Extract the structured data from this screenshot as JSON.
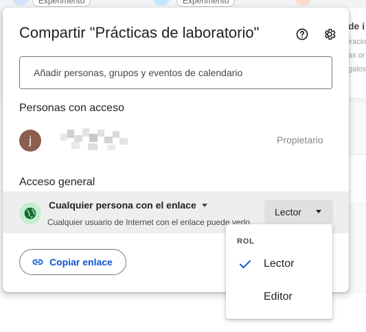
{
  "background": {
    "chips": [
      "Experimento",
      "Experimento"
    ],
    "side_title": "de i",
    "side_lines": [
      "iracio",
      "as or",
      "galos"
    ]
  },
  "dialog": {
    "title": "Compartir \"Prácticas de laboratorio\"",
    "help_icon": "help-circle-icon",
    "settings_icon": "gear-icon",
    "add_input_placeholder": "Añadir personas, grupos y eventos de calendario",
    "people_section_title": "Personas con acceso",
    "people": [
      {
        "avatar_letter": "j",
        "name": "",
        "role": "Propietario"
      }
    ],
    "general_section_title": "Acceso general",
    "general_access": {
      "icon": "globe-icon",
      "link_option": "Cualquier persona con el enlace",
      "description": "Cualquier usuario de Internet con el enlace puede verlo",
      "role": "Lector"
    },
    "copy_link_label": "Copiar enlace",
    "copy_link_icon": "link-icon"
  },
  "role_menu": {
    "header": "ROL",
    "items": [
      {
        "label": "Lector",
        "selected": true
      },
      {
        "label": "Editor",
        "selected": false
      }
    ]
  },
  "colors": {
    "accent_blue": "#0b57d0",
    "avatar_bg": "#8b5e4e",
    "globe_bg": "#c4eed0",
    "globe_fg": "#146c2e"
  }
}
